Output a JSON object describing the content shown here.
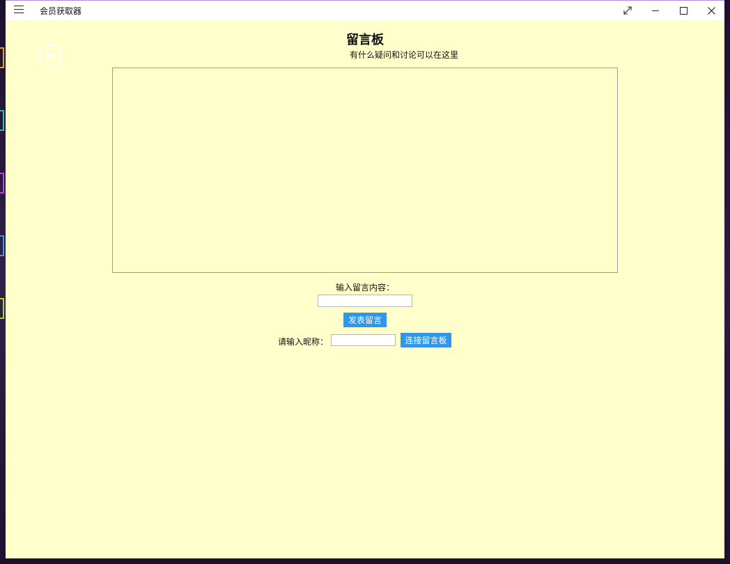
{
  "window": {
    "title": "会员获取器"
  },
  "page": {
    "title": "留言板",
    "subtitle": "有什么疑问和讨论可以在这里"
  },
  "board": {
    "messages": []
  },
  "form": {
    "content_label": "输入留言内容：",
    "content_value": "",
    "post_button": "发表留言",
    "nickname_label": "请输入昵称：",
    "nickname_value": "",
    "connect_button": "连接留言板"
  },
  "colors": {
    "background": "#ffffcc",
    "button": "#2f96e8",
    "titlebar": "#ffffff"
  },
  "icons": {
    "menu": "hamburger-icon",
    "back": "back-arrow-icon",
    "expand": "expand-icon",
    "minimize": "minimize-icon",
    "maximize": "maximize-icon",
    "close": "close-icon"
  }
}
